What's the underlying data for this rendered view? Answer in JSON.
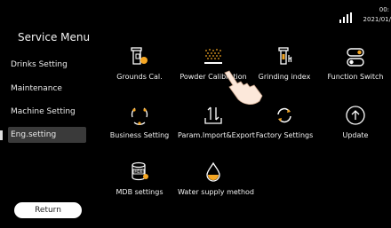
{
  "status": {
    "time": "00:",
    "date": "2021/01/"
  },
  "sidebar": {
    "title": "Service Menu",
    "items": [
      {
        "label": "Drinks Setting"
      },
      {
        "label": "Maintenance"
      },
      {
        "label": "Machine Setting"
      },
      {
        "label": "Eng.setting"
      }
    ],
    "return_label": "Return"
  },
  "tiles": [
    {
      "label": "Grounds Cal.",
      "icon": "grounds-icon"
    },
    {
      "label": "Powder Calibration",
      "icon": "powder-icon"
    },
    {
      "label": "Grinding index",
      "icon": "grinder-icon"
    },
    {
      "label": "Function Switch",
      "icon": "toggle-icon"
    },
    {
      "label": "Business Setting",
      "icon": "cycle-icon"
    },
    {
      "label": "Param.Import&Export",
      "icon": "import-export-icon"
    },
    {
      "label": "Factory Settings",
      "icon": "reset-icon"
    },
    {
      "label": "Update",
      "icon": "upload-icon"
    },
    {
      "label": "MDB settings",
      "icon": "mdb-icon"
    },
    {
      "label": "Water supply method",
      "icon": "water-drop-icon"
    }
  ],
  "colors": {
    "background": "#000000",
    "accent": "#f5a623",
    "active_item": "#3a3a3a"
  }
}
